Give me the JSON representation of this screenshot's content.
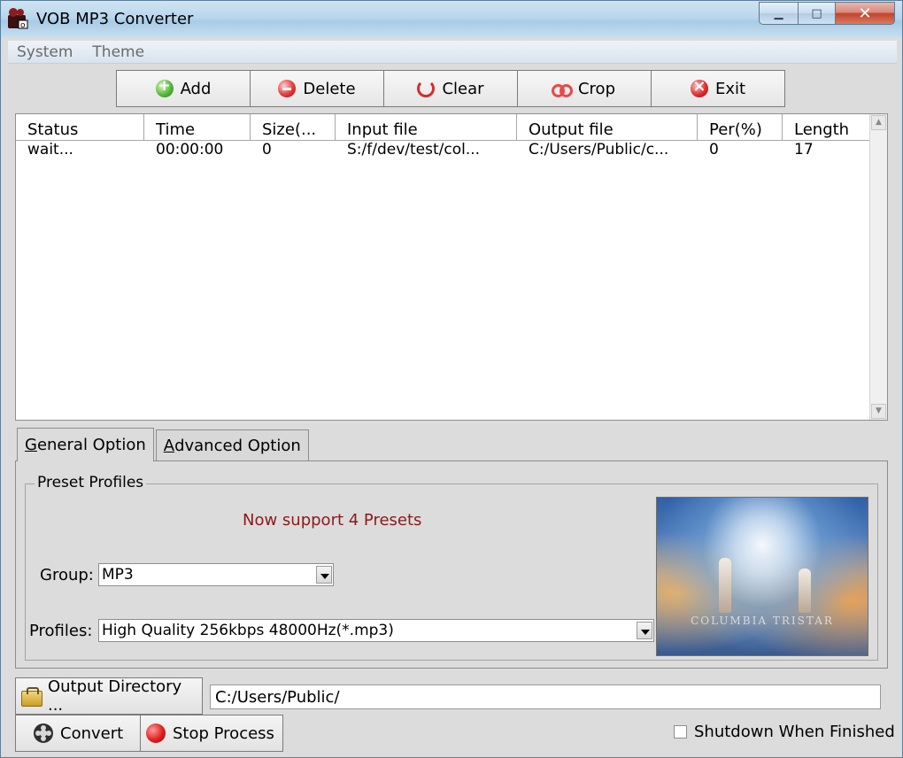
{
  "window": {
    "title": "VOB MP3 Converter",
    "caption": {
      "minimize": "▁",
      "maximize": "□",
      "close": "✕"
    }
  },
  "menu": [
    "System",
    "Theme"
  ],
  "toolbar": {
    "add": "Add",
    "delete": "Delete",
    "clear": "Clear",
    "crop": "Crop",
    "exit": "Exit"
  },
  "list": {
    "columns": [
      "Status",
      "Time",
      "Size(...",
      "Input file",
      "Output file",
      "Per(%)",
      "Length"
    ],
    "rows": [
      [
        "wait...",
        "00:00:00",
        "0",
        "S:/f/dev/test/col...",
        "C:/Users/Public/c...",
        "0",
        "17"
      ]
    ]
  },
  "tabs": {
    "general": {
      "prefix": "G",
      "rest": "eneral Option"
    },
    "advanced": {
      "prefix": "A",
      "rest": "dvanced Option"
    }
  },
  "preset": {
    "legend": "Preset Profiles",
    "support_text": "Now support 4 Presets",
    "group_label": "Group:",
    "group_value": "MP3",
    "profiles_label": "Profiles:",
    "profiles_value": "High Quality 256kbps 48000Hz(*.mp3)",
    "preview_logo": "COLUMBIA TRISTAR"
  },
  "output": {
    "button": "Output Directory ...",
    "path": "C:/Users/Public/"
  },
  "actions": {
    "convert": "Convert",
    "stop": "Stop Process",
    "shutdown": "Shutdown When Finished"
  },
  "colors": {
    "support_text": "#8b1a1a",
    "close_button": "#c3432b"
  }
}
